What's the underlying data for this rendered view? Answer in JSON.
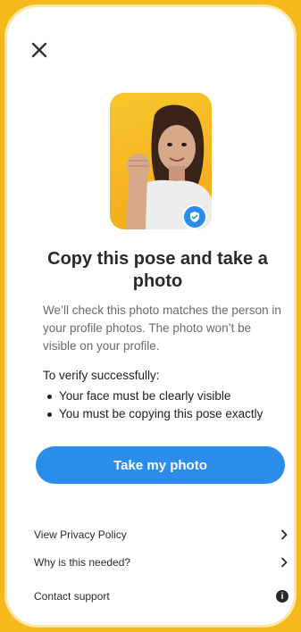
{
  "modal": {
    "heading": "Copy this pose and take a photo",
    "description": "We’ll check this photo matches the person in your profile photos. The photo won’t be visible on your profile.",
    "verify_title": "To verify successfully:",
    "bullets": [
      "Your face must be clearly visible",
      "You must be copying this pose exactly"
    ],
    "primary_button": "Take my photo",
    "links": [
      "View Privacy Policy",
      "Why is this needed?",
      "Contact support"
    ],
    "info_glyph": "i"
  },
  "icons": {
    "close": "close-icon",
    "verified": "shield-check-icon",
    "chevron": "chevron-right-icon",
    "info": "info-icon"
  },
  "colors": {
    "background": "#F6B91C",
    "accent": "#2A8DEB",
    "text": "#2A2A2A",
    "muted_text": "#6A6A6A"
  }
}
